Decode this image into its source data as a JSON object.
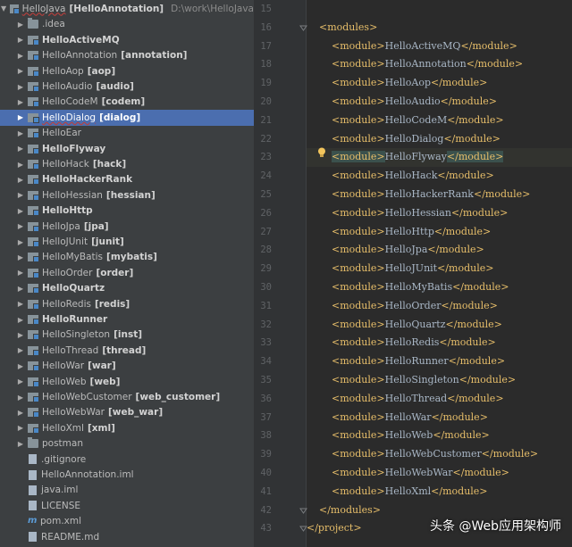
{
  "tree": {
    "root": {
      "name": "HelloJava",
      "tag": "[HelloAnnotation]",
      "path": "D:\\work\\HelloJava"
    },
    "items": [
      {
        "name": ".idea",
        "tag": "",
        "bold": false,
        "icon": "folder-icon"
      },
      {
        "name": "HelloActiveMQ",
        "tag": "",
        "bold": true,
        "icon": "module-folder-icon"
      },
      {
        "name": "HelloAnnotation",
        "tag": "[annotation]",
        "bold": false,
        "icon": "module-folder-icon"
      },
      {
        "name": "HelloAop",
        "tag": "[aop]",
        "bold": false,
        "icon": "module-folder-icon"
      },
      {
        "name": "HelloAudio",
        "tag": "[audio]",
        "bold": false,
        "icon": "module-folder-icon"
      },
      {
        "name": "HelloCodeM",
        "tag": "[codem]",
        "bold": false,
        "icon": "module-folder-icon"
      },
      {
        "name": "HelloDialog",
        "tag": "[dialog]",
        "bold": false,
        "icon": "module-folder-icon",
        "selected": true
      },
      {
        "name": "HelloEar",
        "tag": "",
        "bold": false,
        "icon": "module-folder-icon"
      },
      {
        "name": "HelloFlyway",
        "tag": "",
        "bold": true,
        "icon": "module-folder-icon"
      },
      {
        "name": "HelloHack",
        "tag": "[hack]",
        "bold": false,
        "icon": "module-folder-icon"
      },
      {
        "name": "HelloHackerRank",
        "tag": "",
        "bold": true,
        "icon": "module-folder-icon"
      },
      {
        "name": "HelloHessian",
        "tag": "[hessian]",
        "bold": false,
        "icon": "module-folder-icon"
      },
      {
        "name": "HelloHttp",
        "tag": "",
        "bold": true,
        "icon": "module-folder-icon"
      },
      {
        "name": "HelloJpa",
        "tag": "[jpa]",
        "bold": false,
        "icon": "module-folder-icon"
      },
      {
        "name": "HelloJUnit",
        "tag": "[junit]",
        "bold": false,
        "icon": "module-folder-icon"
      },
      {
        "name": "HelloMyBatis",
        "tag": "[mybatis]",
        "bold": false,
        "icon": "module-folder-icon"
      },
      {
        "name": "HelloOrder",
        "tag": "[order]",
        "bold": false,
        "icon": "module-folder-icon"
      },
      {
        "name": "HelloQuartz",
        "tag": "",
        "bold": true,
        "icon": "module-folder-icon"
      },
      {
        "name": "HelloRedis",
        "tag": "[redis]",
        "bold": false,
        "icon": "module-folder-icon"
      },
      {
        "name": "HelloRunner",
        "tag": "",
        "bold": true,
        "icon": "module-folder-icon"
      },
      {
        "name": "HelloSingleton",
        "tag": "[inst]",
        "bold": false,
        "icon": "module-folder-icon"
      },
      {
        "name": "HelloThread",
        "tag": "[thread]",
        "bold": false,
        "icon": "module-folder-icon"
      },
      {
        "name": "HelloWar",
        "tag": "[war]",
        "bold": false,
        "icon": "module-folder-icon"
      },
      {
        "name": "HelloWeb",
        "tag": "[web]",
        "bold": false,
        "icon": "module-folder-icon"
      },
      {
        "name": "HelloWebCustomer",
        "tag": "[web_customer]",
        "bold": false,
        "icon": "module-folder-icon"
      },
      {
        "name": "HelloWebWar",
        "tag": "[web_war]",
        "bold": false,
        "icon": "module-folder-icon"
      },
      {
        "name": "HelloXml",
        "tag": "[xml]",
        "bold": false,
        "icon": "module-folder-icon"
      },
      {
        "name": "postman",
        "tag": "",
        "bold": false,
        "icon": "folder-icon"
      }
    ],
    "files": [
      {
        "name": ".gitignore",
        "icon": "file-icon"
      },
      {
        "name": "HelloAnnotation.iml",
        "icon": "file-icon"
      },
      {
        "name": "java.iml",
        "icon": "file-icon"
      },
      {
        "name": "LICENSE",
        "icon": "file-icon"
      },
      {
        "name": "pom.xml",
        "icon": "maven-icon"
      },
      {
        "name": "README.md",
        "icon": "file-icon"
      }
    ]
  },
  "editor": {
    "first_line": 15,
    "indent_tag": "modules",
    "modules": [
      "HelloActiveMQ",
      "HelloAnnotation",
      "HelloAop",
      "HelloAudio",
      "HelloCodeM",
      "HelloDialog",
      "HelloFlyway",
      "HelloHack",
      "HelloHackerRank",
      "HelloHessian",
      "HelloHttp",
      "HelloJpa",
      "HelloJUnit",
      "HelloMyBatis",
      "HelloOrder",
      "HelloQuartz",
      "HelloRedis",
      "HelloRunner",
      "HelloSingleton",
      "HelloThread",
      "HelloWar",
      "HelloWeb",
      "HelloWebCustomer",
      "HelloWebWar",
      "HelloXml"
    ],
    "highlighted_module": "HelloFlyway",
    "lines": {
      "modules_open": "<modules>",
      "modules_close": "</modules>",
      "project_close": "</project>"
    }
  },
  "watermark": "头条 @Web应用架构师",
  "colors": {
    "tree_bg": "#3c3f41",
    "editor_bg": "#2b2b2b",
    "selection": "#4b6eaf",
    "tag": "#e8bf6a",
    "text": "#a9b7c6"
  }
}
